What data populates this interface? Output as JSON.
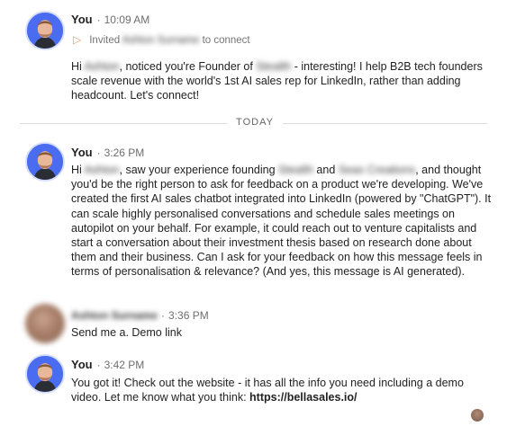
{
  "messages": [
    {
      "sender": "You",
      "time": "10:09 AM",
      "invite": {
        "prefix": "Invited",
        "name": "Ashton Surname",
        "suffix": "to connect"
      },
      "parts": [
        "Hi ",
        "Ashton",
        ", noticed you're Founder of ",
        "Stealth",
        " - interesting! I help B2B tech founders scale revenue with the world's 1st AI sales rep for LinkedIn, rather than adding headcount. Let's connect!"
      ]
    },
    {
      "sender": "You",
      "time": "3:26 PM",
      "parts": [
        "Hi ",
        "Ashton",
        ", saw your experience founding ",
        "Stealth",
        " and ",
        "Seas Creations",
        ", and thought you'd be the right person to ask for feedback on a product we're developing. We've created the first AI sales chatbot integrated into LinkedIn (powered by \"ChatGPT\"). It can scale highly personalised conversations and schedule sales meetings on autopilot on your behalf. For example, it could reach out to venture capitalists and start a conversation about their investment thesis based on research done about them and their business. Can I ask for your feedback on how this message feels in terms of personalisation & relevance? (And yes, this message is AI generated)."
      ]
    },
    {
      "sender": "Ashton Surname",
      "time": "3:36 PM",
      "text": "Send me a. Demo link"
    },
    {
      "sender": "You",
      "time": "3:42 PM",
      "text_before_link": "You got it! Check out the website - it has all the info you need including a demo video.  Let me know what you think: ",
      "link": "https://bellasales.io/"
    }
  ],
  "divider": "TODAY"
}
